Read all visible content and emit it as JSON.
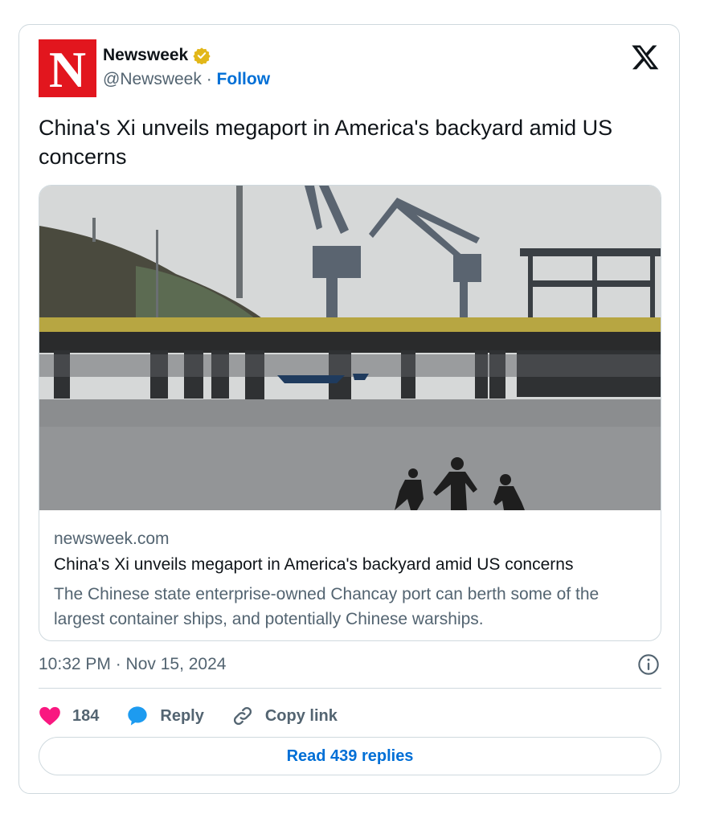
{
  "colors": {
    "brand": "#e2161e",
    "link": "#006fd6",
    "like": "#f91880",
    "reply": "#1d9bf0",
    "muted": "#536471"
  },
  "author": {
    "logo_letter": "N",
    "name": "Newsweek",
    "handle": "@Newsweek",
    "separator": "·",
    "follow_label": "Follow"
  },
  "icons": {
    "verified": "gold-verified-badge-icon",
    "platform": "x-logo-icon"
  },
  "tweet": {
    "text": "China's Xi unveils megaport in America's backyard amid US concerns"
  },
  "preview": {
    "domain": "newsweek.com",
    "title": "China's Xi unveils megaport in America's backyard amid US concerns",
    "description": "The Chinese state enterprise-owned Chancay port can berth some of the largest container ships, and potentially Chinese warships."
  },
  "meta": {
    "timestamp": "10:32 PM · Nov 15, 2024"
  },
  "actions": {
    "like_count": "184",
    "reply_label": "Reply",
    "copy_label": "Copy link"
  },
  "footer": {
    "read_replies_label": "Read 439 replies"
  }
}
